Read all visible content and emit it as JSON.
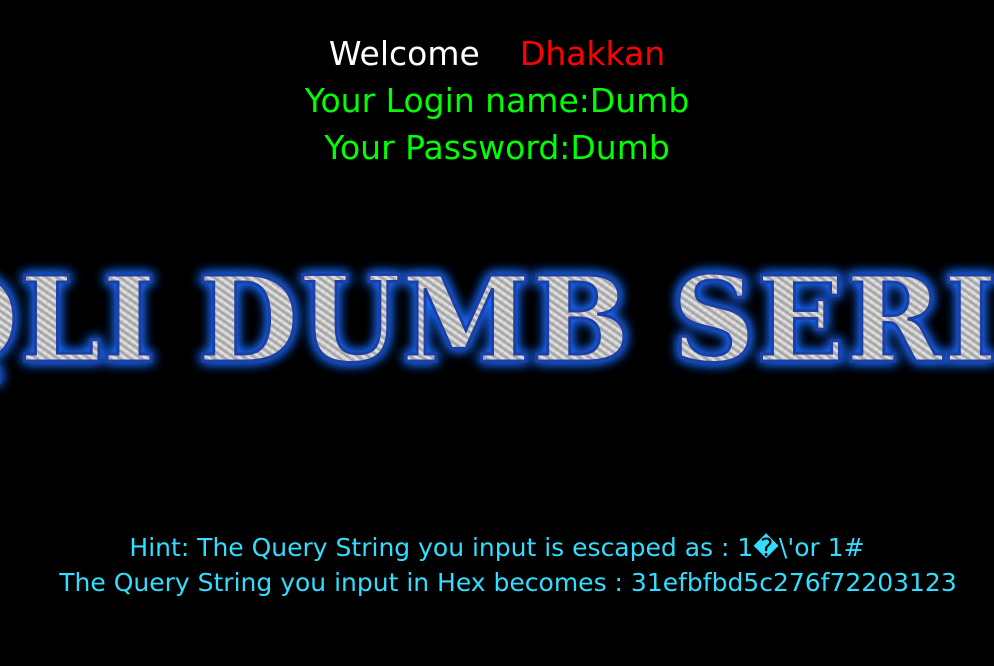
{
  "welcome": {
    "greeting": "Welcome",
    "user_name": "Dhakkan",
    "login_line": "Your Login name:Dumb",
    "password_line": "Your Password:Dumb"
  },
  "banner": {
    "text": "SQLI DUMB SERIES"
  },
  "hint": {
    "escaped_line": "Hint: The Query String you input is escaped as : 1�\\'or 1#",
    "hex_line": "The Query String you input in Hex becomes : 31efbfbd5c276f72203123"
  },
  "colors": {
    "background": "#000000",
    "greeting": "#ffffff",
    "user_name": "#ff0000",
    "credentials": "#00ff00",
    "hint": "#33ddff",
    "banner_glow": "#1e6bff"
  }
}
